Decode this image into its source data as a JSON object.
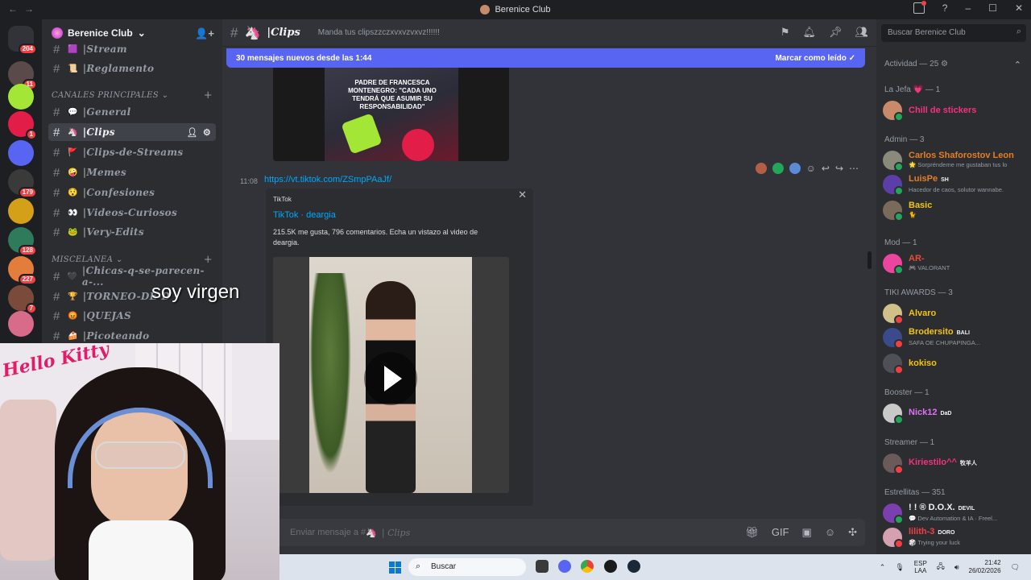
{
  "window": {
    "title": "Berenice Club",
    "nav_back": "←",
    "nav_forward": "→"
  },
  "rail": {
    "servers": [
      {
        "name": "Discord",
        "badge": "204",
        "color": "#313338"
      },
      {
        "name": "server-2",
        "badge": "11",
        "color": "#5a4a4a"
      },
      {
        "name": "server-3",
        "badge": "",
        "color": "#a3e635"
      },
      {
        "name": "server-4",
        "badge": "1",
        "color": "#e11d48"
      },
      {
        "name": "server-5",
        "badge": "",
        "color": "#5865f2"
      },
      {
        "name": "server-6",
        "badge": "179",
        "color": "#3a3a3a"
      },
      {
        "name": "server-7",
        "badge": "",
        "color": "#d4a017"
      },
      {
        "name": "server-8",
        "badge": "128",
        "color": "#2f7a5a"
      },
      {
        "name": "server-9",
        "badge": "227",
        "color": "#e27d3b"
      },
      {
        "name": "server-10",
        "badge": "7",
        "color": "#7a4a3a"
      },
      {
        "name": "server-11",
        "badge": "",
        "color": "#d86a8a"
      }
    ]
  },
  "sidebar": {
    "server_name": "Berenice Club",
    "server_chevron": "⌄",
    "invite_icon": "👤+",
    "top_channels": [
      {
        "emoji": "🟪",
        "name": "Stream"
      },
      {
        "emoji": "📜",
        "name": "Reglamento"
      }
    ],
    "category_main": "CANALES PRINCIPALES",
    "channels_main": [
      {
        "emoji": "💬",
        "name": "General"
      },
      {
        "emoji": "🦄",
        "name": "Clips"
      },
      {
        "emoji": "🚩",
        "name": "Clips-de-Streams"
      },
      {
        "emoji": "🤪",
        "name": "Memes"
      },
      {
        "emoji": "😯",
        "name": "Confesiones"
      },
      {
        "emoji": "👀",
        "name": "Videos-Curiosos"
      },
      {
        "emoji": "🐸",
        "name": "Very-Edits"
      }
    ],
    "category_misc": "MISCELANEA",
    "channels_misc": [
      {
        "emoji": "🖤",
        "name": "Chicas-q-se-parecen-a-..."
      },
      {
        "emoji": "🏆",
        "name": "TORNEO-DE-D"
      },
      {
        "emoji": "😡",
        "name": "QUEJAS"
      },
      {
        "emoji": "🍰",
        "name": "Picoteando"
      }
    ],
    "hash": "#",
    "plus": "+"
  },
  "main": {
    "channel_name": "Clips",
    "channel_emoji": "🦄",
    "topic": "Manda tus clipszzczxvxvzvxvz!!!!!!",
    "new_messages": "30 mensajes nuevos desde las 1:44",
    "mark_read": "Marcar como leído",
    "prev_image_caption": "PADRE DE FRANCESCA MONTENEGRO: \"CADA UNO TENDRÁ QUE ASUMIR SU RESPONSABILIDAD\"",
    "message": {
      "time": "11:08",
      "link": "https://vt.tiktok.com/ZSmpPAaJf/"
    },
    "embed": {
      "provider": "TikTok",
      "title": "TikTok · deargia",
      "description": "215.5K me gusta, 796 comentarios. Echa un vistazo al video de deargia.",
      "close": "✕"
    },
    "composer_placeholder": "Enviar mensaje a #",
    "composer_channel": "Clips"
  },
  "members": {
    "search_placeholder": "Buscar Berenice Club",
    "activity_header": "Actividad — 25",
    "groups": [
      {
        "header": "La Jefa 💗 — 1",
        "members": [
          {
            "name": "Chill de stickers",
            "sub": "",
            "color": "#f5317f",
            "avatar": "#c9896b",
            "status": "#23a55a",
            "tag": ""
          }
        ]
      },
      {
        "header": "Admin — 3",
        "members": [
          {
            "name": "Carlos Shaforostov Leon",
            "sub": "🌟 Sorpréndeme me gustaban tus lo",
            "color": "#e67e22",
            "avatar": "#8a8a7a",
            "status": "#23a55a",
            "tag": ""
          },
          {
            "name": "LuisPe",
            "sub": "Hacedor de caos, solutor wannabe.",
            "color": "#e67e22",
            "avatar": "#5b3ea8",
            "status": "#23a55a",
            "tag": "SH"
          },
          {
            "name": "Basic",
            "sub": "🐈",
            "color": "#f1c40f",
            "avatar": "#7a6a5a",
            "status": "#23a55a",
            "tag": ""
          }
        ]
      },
      {
        "header": "Mod — 1",
        "members": [
          {
            "name": "AR-",
            "sub": "🎮 VALORANT",
            "color": "#e74c3c",
            "avatar": "#eb459e",
            "status": "#23a55a",
            "tag": ""
          }
        ]
      },
      {
        "header": "TIKI AWARDS — 3",
        "members": [
          {
            "name": "Alvaro",
            "sub": "",
            "color": "#f1c40f",
            "avatar": "#d0c08a",
            "status": "#f23f43",
            "tag": ""
          },
          {
            "name": "Brodersito",
            "sub": "SAFA OE CHUPAPINGA...",
            "color": "#f1c40f",
            "avatar": "#3a4a8a",
            "status": "#f23f43",
            "tag": "BALI"
          },
          {
            "name": "kokiso",
            "sub": "",
            "color": "#f1c40f",
            "avatar": "#4e5058",
            "status": "#f23f43",
            "tag": ""
          }
        ]
      },
      {
        "header": "Booster — 1",
        "members": [
          {
            "name": "Nick12",
            "sub": "",
            "color": "#e36ef7",
            "avatar": "#c9c9c9",
            "status": "#23a55a",
            "tag": "DaD"
          }
        ]
      },
      {
        "header": "Streamer — 1",
        "members": [
          {
            "name": "Kiriestilo^^",
            "sub": "",
            "color": "#f5317f",
            "avatar": "#6a5a5a",
            "status": "#f23f43",
            "tag": "牧羊人"
          }
        ]
      },
      {
        "header": "Estrellitas — 351",
        "members": [
          {
            "name": "! ! ® D.O.X.",
            "sub": "💬 Dev Automation & IA · Freel...",
            "color": "#f2f3f5",
            "avatar": "#7b3fb0",
            "status": "#23a55a",
            "tag": "DEVIL"
          },
          {
            "name": "lilith-3",
            "sub": "🎲 Trying your luck",
            "color": "#f23f43",
            "avatar": "#d5a0b0",
            "status": "#f23f43",
            "tag": "DORO"
          }
        ]
      }
    ]
  },
  "overlay": {
    "subtitle": "soy virgen",
    "webcam_sign": "Hello Kitty"
  },
  "taskbar": {
    "search": "Buscar",
    "lang_top": "ESP",
    "lang_bottom": "LAA",
    "time": "21:42",
    "date": "26/02/2026"
  }
}
